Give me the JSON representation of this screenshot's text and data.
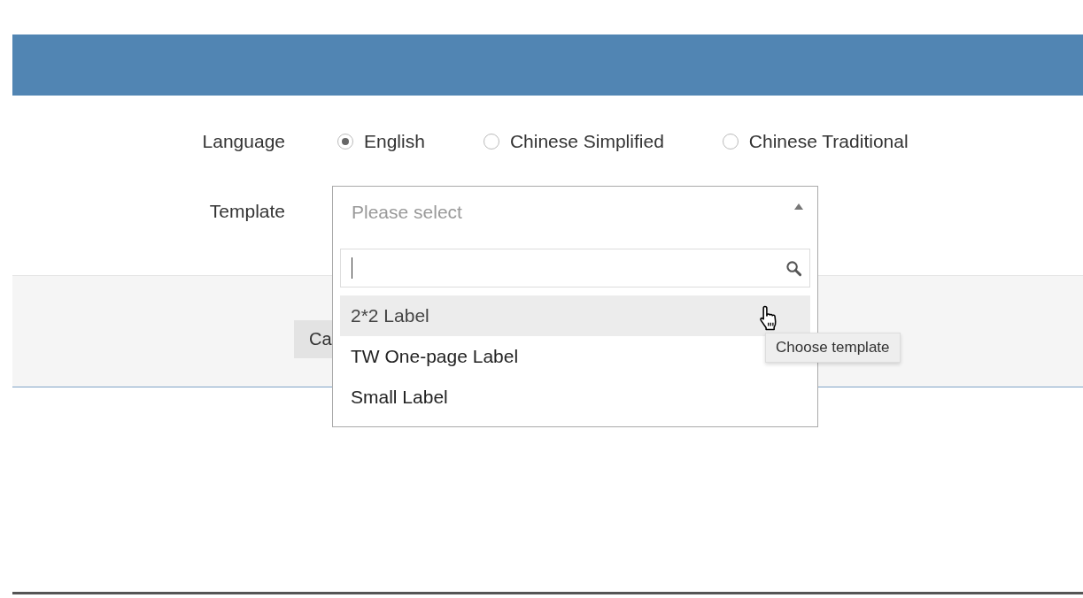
{
  "form": {
    "language": {
      "label": "Language",
      "options": [
        {
          "label": "English",
          "selected": true
        },
        {
          "label": "Chinese Simplified",
          "selected": false
        },
        {
          "label": "Chinese Traditional",
          "selected": false
        }
      ]
    },
    "template": {
      "label": "Template",
      "placeholder": "Please select",
      "expanded": true,
      "options": [
        {
          "label": "2*2 Label",
          "highlighted": true
        },
        {
          "label": "TW One-page Label",
          "highlighted": false
        },
        {
          "label": "Small Label",
          "highlighted": false
        }
      ]
    }
  },
  "footer": {
    "buttons": [
      "Ca"
    ]
  },
  "tooltip": {
    "text": "Choose template"
  }
}
